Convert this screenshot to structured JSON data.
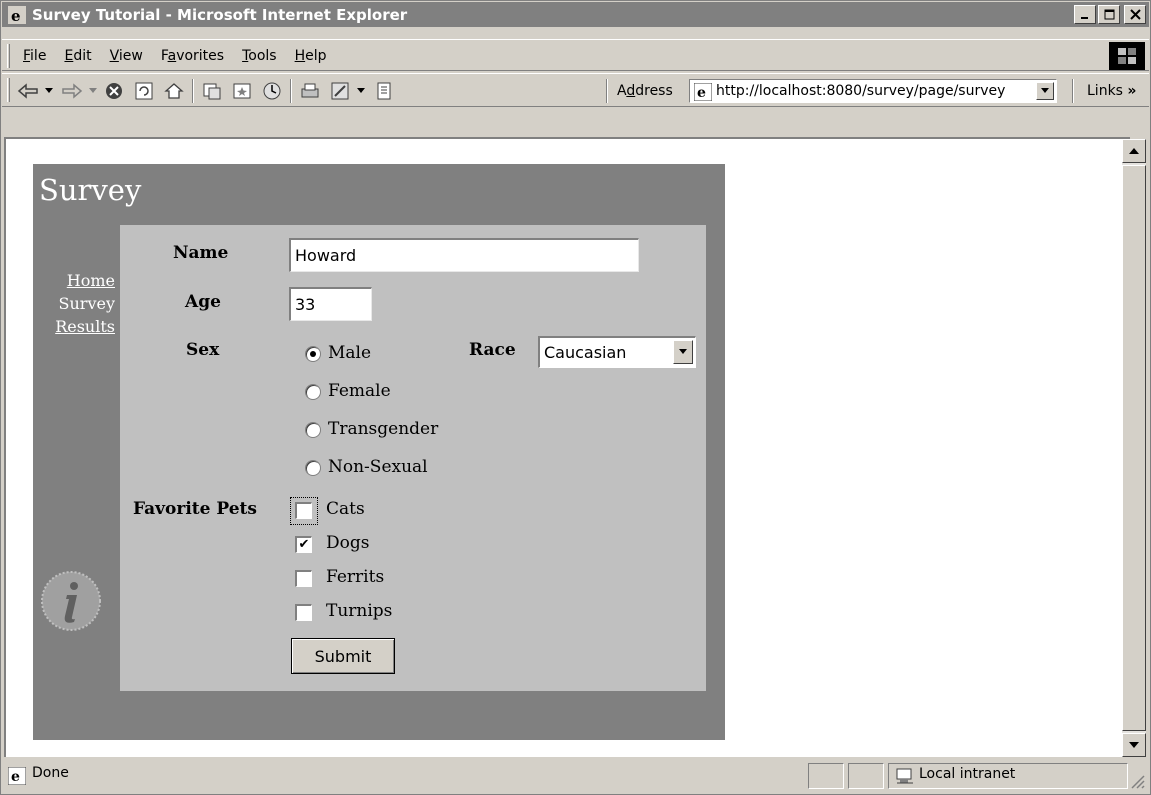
{
  "window": {
    "title": "Survey Tutorial - Microsoft Internet Explorer",
    "controls": [
      "minimize",
      "maximize",
      "close"
    ]
  },
  "menu": {
    "items": [
      {
        "label": "File",
        "accel": "F"
      },
      {
        "label": "Edit",
        "accel": "E"
      },
      {
        "label": "View",
        "accel": "V"
      },
      {
        "label": "Favorites",
        "accel": "a"
      },
      {
        "label": "Tools",
        "accel": "T"
      },
      {
        "label": "Help",
        "accel": "H"
      }
    ]
  },
  "toolbar": {
    "icons": [
      "back-icon",
      "forward-icon",
      "stop-icon",
      "refresh-icon",
      "home-icon",
      "search-icon",
      "favorites-icon",
      "history-icon",
      "print-icon",
      "edit-icon",
      "discuss-icon"
    ],
    "address_label": "Address",
    "address_value": "http://localhost:8080/survey/page/survey",
    "links_label": "Links"
  },
  "page": {
    "title": "Survey",
    "nav": {
      "home": "Home",
      "survey": "Survey",
      "results": "Results"
    },
    "form": {
      "name_label": "Name",
      "name_value": "Howard",
      "age_label": "Age",
      "age_value": "33",
      "sex_label": "Sex",
      "sex_options": [
        "Male",
        "Female",
        "Transgender",
        "Non-Sexual"
      ],
      "sex_selected": "Male",
      "race_label": "Race",
      "race_value": "Caucasian",
      "pets_label": "Favorite Pets",
      "pets_options": [
        "Cats",
        "Dogs",
        "Ferrits",
        "Turnips"
      ],
      "pets_checked": [
        "Dogs"
      ],
      "submit_label": "Submit"
    }
  },
  "status": {
    "text": "Done",
    "zone": "Local intranet"
  }
}
